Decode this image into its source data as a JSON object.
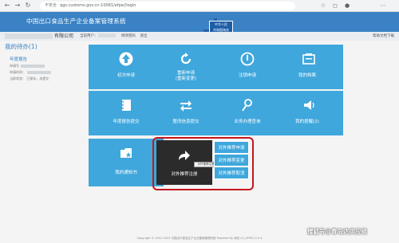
{
  "browser": {
    "security_label": "不安全",
    "url": "qgs.customs.gov.cn:10081/efpe//login",
    "icons": [
      "back-icon",
      "forward-icon",
      "reload-icon",
      "star-icon",
      "menu-icon"
    ]
  },
  "header": {
    "title": "中国出口食品生产企业备案管理系统",
    "logo_text_1": "中华人民",
    "logo_text_2": "共和国海关"
  },
  "subbar": {
    "company_suffix": "有限公司",
    "current_user_label": "当前用户：",
    "change_password": "修改密码",
    "logout": "退出",
    "help": "帮助文档下载"
  },
  "todo": {
    "title": "我的待办(1)",
    "subtitle": "年度报告",
    "lines": [
      "申请号",
      "申请时间：",
      "当前状态：  已保存，未提交"
    ]
  },
  "tiles": [
    {
      "label": "初次申请",
      "icon": "up-arrow-icon"
    },
    {
      "label": "重新申请",
      "label2": "(重新变更)",
      "icon": "refresh-icon"
    },
    {
      "label": "注销申请",
      "icon": "power-icon"
    },
    {
      "label": "我的档案",
      "icon": "archive-icon"
    },
    {
      "label": "年度报告提交",
      "icon": "notebook-icon"
    },
    {
      "label": "整改信息提交",
      "icon": "swap-arrows-icon"
    },
    {
      "label": "业务办理查询",
      "icon": "person-search-icon"
    },
    {
      "label": "我的提醒(2)",
      "icon": "speaker-icon"
    },
    {
      "label": "我的通知书",
      "icon": "folder-star-icon"
    }
  ],
  "recommend": {
    "label": "对外推荐注册",
    "tooltip": "对外推荐注册",
    "options": [
      "对外推荐申请",
      "对外推荐变更",
      "对外推荐取消"
    ]
  },
  "footer": "Copyright © 2012-2022 中国出口食品生产企业备案管理系统 Powered By 海关 LH_EFPE2.0.0.4",
  "watermark": "搜狐号@青岛达供应链",
  "colors": {
    "tile": "#3fa7dc",
    "header": "#3a82c4",
    "highlight": "#c4151c",
    "dark_tile": "#2b2b2b"
  }
}
